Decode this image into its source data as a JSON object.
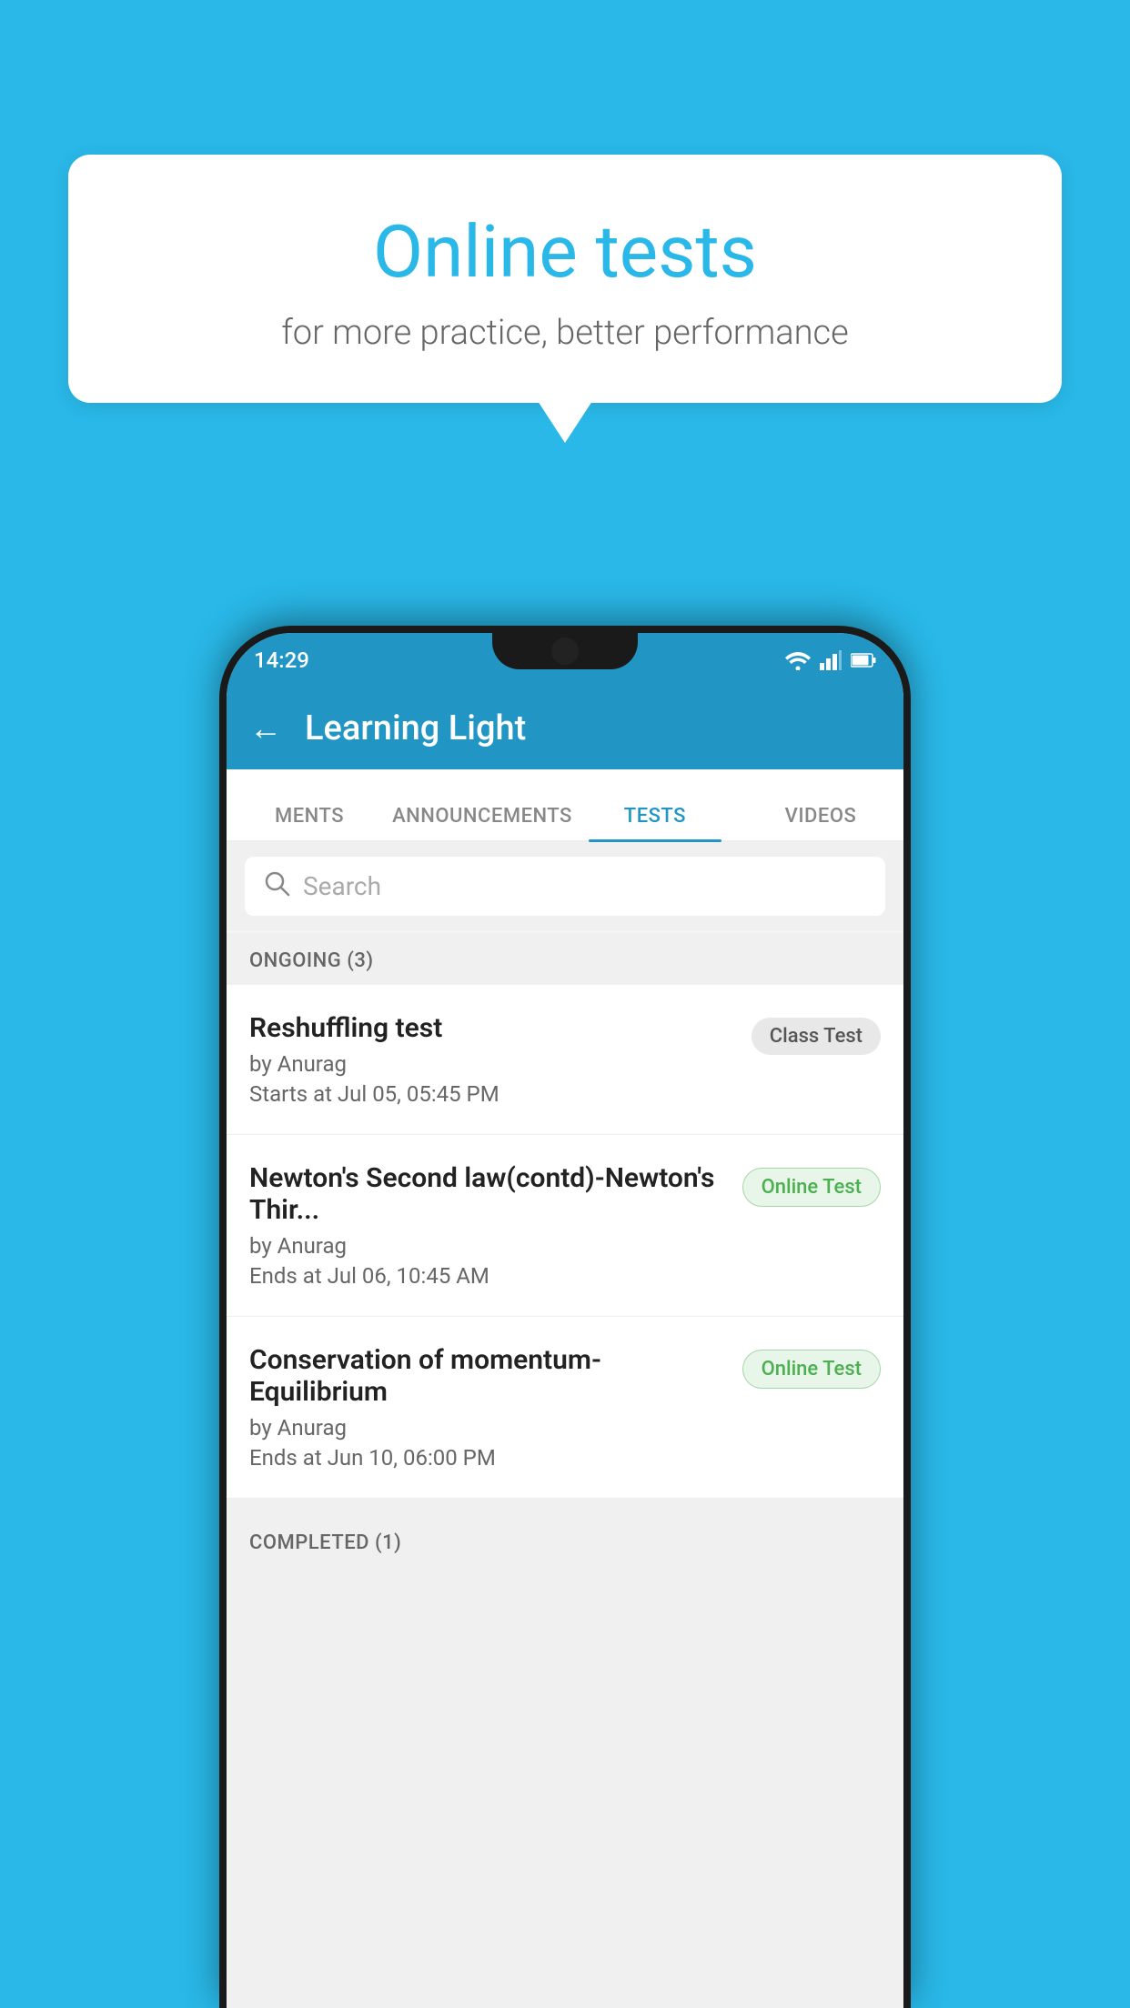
{
  "background_color": "#29b8e8",
  "speech_bubble": {
    "title": "Online tests",
    "subtitle": "for more practice, better performance"
  },
  "phone": {
    "status_bar": {
      "time": "14:29",
      "icons": [
        "wifi",
        "signal",
        "battery"
      ]
    },
    "app_bar": {
      "title": "Learning Light",
      "back_label": "←"
    },
    "tabs": [
      {
        "label": "MENTS",
        "active": false
      },
      {
        "label": "ANNOUNCEMENTS",
        "active": false
      },
      {
        "label": "TESTS",
        "active": true
      },
      {
        "label": "VIDEOS",
        "active": false
      }
    ],
    "search": {
      "placeholder": "Search"
    },
    "sections": [
      {
        "header": "ONGOING (3)",
        "items": [
          {
            "title": "Reshuffling test",
            "author": "by Anurag",
            "time": "Starts at  Jul 05, 05:45 PM",
            "badge": "Class Test",
            "badge_type": "class"
          },
          {
            "title": "Newton's Second law(contd)-Newton's Thir...",
            "author": "by Anurag",
            "time": "Ends at  Jul 06, 10:45 AM",
            "badge": "Online Test",
            "badge_type": "online"
          },
          {
            "title": "Conservation of momentum-Equilibrium",
            "author": "by Anurag",
            "time": "Ends at  Jun 10, 06:00 PM",
            "badge": "Online Test",
            "badge_type": "online"
          }
        ]
      },
      {
        "header": "COMPLETED (1)",
        "items": []
      }
    ]
  }
}
